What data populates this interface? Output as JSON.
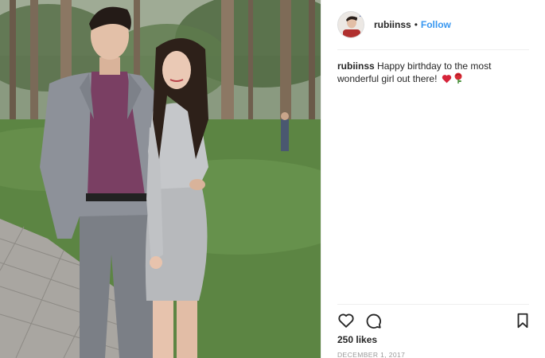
{
  "post": {
    "photo_alt": "",
    "header": {
      "username": "rubiinss",
      "separator": "•",
      "follow_label": "Follow"
    },
    "caption": {
      "username": "rubiinss",
      "text": "Happy birthday to the most wonderful girl out there!",
      "emojis": [
        "heart-icon",
        "rose-icon"
      ]
    },
    "actions": [
      "heart-outline-icon",
      "comment-icon",
      "bookmark-icon"
    ],
    "likes": "250 likes",
    "date": "DECEMBER 1, 2017"
  },
  "colors": {
    "link_blue": "#3897f0",
    "text": "#262626",
    "muted": "#999999",
    "divider": "#efefef",
    "heart_red": "#e0245e"
  }
}
